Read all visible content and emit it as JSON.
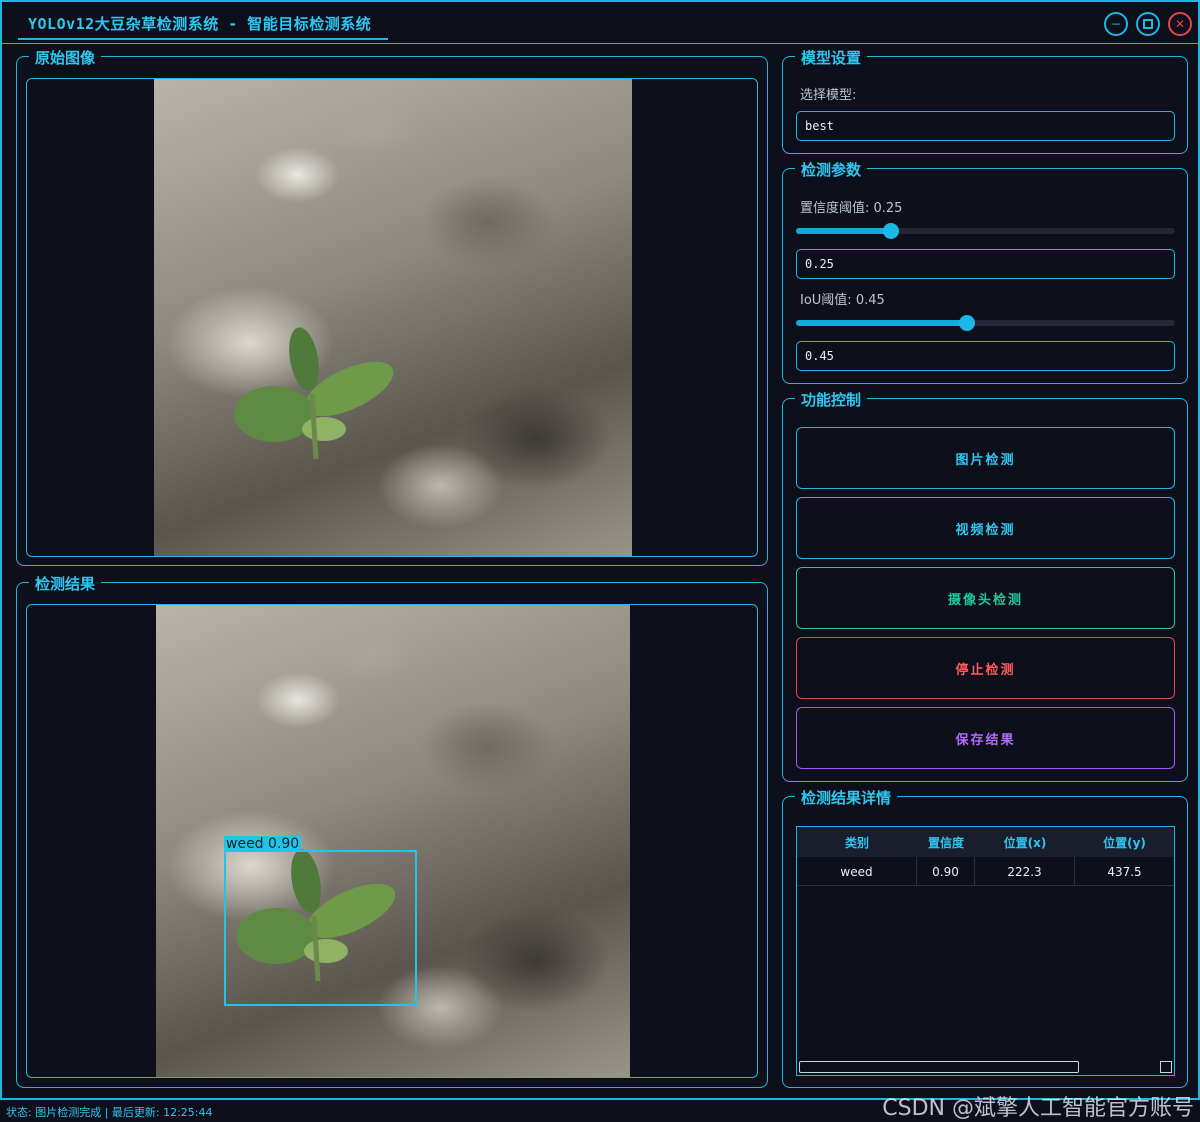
{
  "window": {
    "title": "YOLOv12大豆杂草检测系统 - 智能目标检测系统"
  },
  "original": {
    "title": "原始图像"
  },
  "result": {
    "title": "检测结果",
    "detection_label": "weed 0.90"
  },
  "model": {
    "title": "模型设置",
    "select_label": "选择模型:",
    "selected": "best"
  },
  "params": {
    "title": "检测参数",
    "conf_label": "置信度阈值: 0.25",
    "conf_value": "0.25",
    "conf_fraction": 0.25,
    "iou_label": "IoU阈值: 0.45",
    "iou_value": "0.45",
    "iou_fraction": 0.45
  },
  "controls": {
    "title": "功能控制",
    "image_detect": "图片检测",
    "video_detect": "视频检测",
    "camera_detect": "摄像头检测",
    "stop_detect": "停止检测",
    "save_results": "保存结果"
  },
  "details": {
    "title": "检测结果详情",
    "columns": [
      "类别",
      "置信度",
      "位置(x)",
      "位置(y)"
    ],
    "rows": [
      [
        "weed",
        "0.90",
        "222.3",
        "437.5"
      ]
    ]
  },
  "status": {
    "text": "状态: 图片检测完成 | 最后更新: 12:25:44"
  },
  "watermark": "CSDN @斌擎人工智能官方账号",
  "colors": {
    "accent": "#1fb6e0",
    "camera": "#1fc79a",
    "stop": "#e0464a",
    "save": "#a855f7"
  }
}
